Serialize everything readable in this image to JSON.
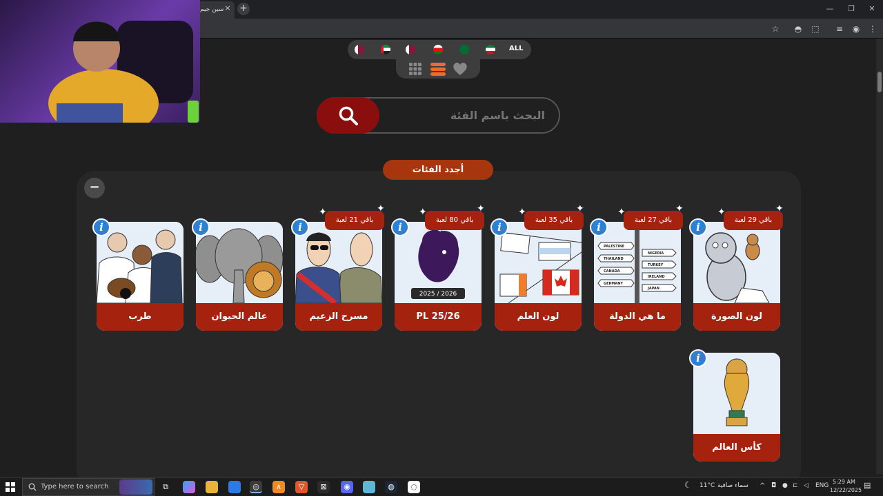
{
  "browser": {
    "tab_title": "سين جيم",
    "tab_close": "×",
    "new_tab": "+",
    "window_controls": {
      "minimize": "—",
      "maximize": "❐",
      "close": "✕"
    }
  },
  "flags": {
    "all_label": "ALL",
    "items": [
      "qatar",
      "uae",
      "qatar",
      "oman",
      "saudi",
      "kuwait"
    ]
  },
  "search": {
    "placeholder": "البحث باسم الفئة"
  },
  "section": {
    "title": "أجدد الفئات",
    "collapse": "−"
  },
  "cards": [
    {
      "label": "لون الصورة",
      "remaining": "باقي 29 لعبة",
      "image": "tom-and-jerry"
    },
    {
      "label": "ما هي الدولة",
      "remaining": "باقي 27 لعبة",
      "image": "country-signpost",
      "signs": [
        "PALESTINE",
        "THAILAND",
        "CANADA",
        "GERMANY",
        "NIGERIA",
        "TURKEY",
        "IRELAND",
        "JAPAN"
      ]
    },
    {
      "label": "لون العلم",
      "remaining": "باقي 35 لعبة",
      "image": "flag-outlines"
    },
    {
      "label": "PL 25/26",
      "remaining": "باقي 80 لعبة",
      "image": "premier-league-lion",
      "season": "2025 / 2026"
    },
    {
      "label": "مسرح الزعيم",
      "remaining": "باقي 21 لعبة",
      "image": "theater-actors"
    },
    {
      "label": "عالم الحيوان",
      "remaining": "",
      "image": "elephant-lion"
    },
    {
      "label": "طرب",
      "remaining": "",
      "image": "oud-singers"
    },
    {
      "label": "كأس العالم",
      "remaining": "",
      "image": "world-cup-trophy"
    }
  ],
  "info_glyph": "i",
  "taskbar": {
    "search_placeholder": "Type here to search",
    "weather_temp": "11°C",
    "weather_desc": "سماء صافية",
    "language": "ENG",
    "time": "5:29 AM",
    "date": "12/22/2025"
  },
  "colors": {
    "accent": "#a5220f",
    "search_button": "#8b0e0e",
    "section_pill": "#a7350e",
    "info": "#2f7fd4",
    "page_bg": "#1f1f1f"
  }
}
